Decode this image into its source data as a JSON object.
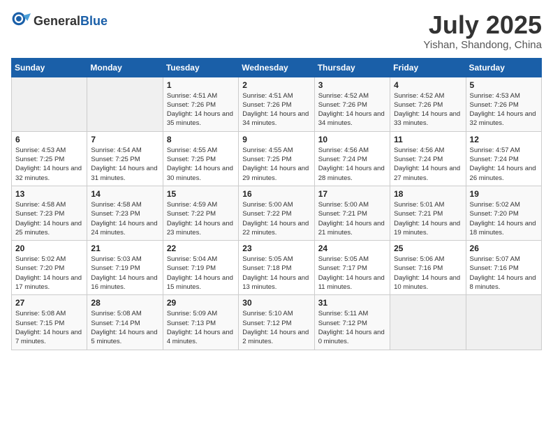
{
  "header": {
    "logo_general": "General",
    "logo_blue": "Blue",
    "month": "July 2025",
    "location": "Yishan, Shandong, China"
  },
  "weekdays": [
    "Sunday",
    "Monday",
    "Tuesday",
    "Wednesday",
    "Thursday",
    "Friday",
    "Saturday"
  ],
  "weeks": [
    [
      {
        "day": "",
        "sunrise": "",
        "sunset": "",
        "daylight": ""
      },
      {
        "day": "",
        "sunrise": "",
        "sunset": "",
        "daylight": ""
      },
      {
        "day": "1",
        "sunrise": "Sunrise: 4:51 AM",
        "sunset": "Sunset: 7:26 PM",
        "daylight": "Daylight: 14 hours and 35 minutes."
      },
      {
        "day": "2",
        "sunrise": "Sunrise: 4:51 AM",
        "sunset": "Sunset: 7:26 PM",
        "daylight": "Daylight: 14 hours and 34 minutes."
      },
      {
        "day": "3",
        "sunrise": "Sunrise: 4:52 AM",
        "sunset": "Sunset: 7:26 PM",
        "daylight": "Daylight: 14 hours and 34 minutes."
      },
      {
        "day": "4",
        "sunrise": "Sunrise: 4:52 AM",
        "sunset": "Sunset: 7:26 PM",
        "daylight": "Daylight: 14 hours and 33 minutes."
      },
      {
        "day": "5",
        "sunrise": "Sunrise: 4:53 AM",
        "sunset": "Sunset: 7:26 PM",
        "daylight": "Daylight: 14 hours and 32 minutes."
      }
    ],
    [
      {
        "day": "6",
        "sunrise": "Sunrise: 4:53 AM",
        "sunset": "Sunset: 7:25 PM",
        "daylight": "Daylight: 14 hours and 32 minutes."
      },
      {
        "day": "7",
        "sunrise": "Sunrise: 4:54 AM",
        "sunset": "Sunset: 7:25 PM",
        "daylight": "Daylight: 14 hours and 31 minutes."
      },
      {
        "day": "8",
        "sunrise": "Sunrise: 4:55 AM",
        "sunset": "Sunset: 7:25 PM",
        "daylight": "Daylight: 14 hours and 30 minutes."
      },
      {
        "day": "9",
        "sunrise": "Sunrise: 4:55 AM",
        "sunset": "Sunset: 7:25 PM",
        "daylight": "Daylight: 14 hours and 29 minutes."
      },
      {
        "day": "10",
        "sunrise": "Sunrise: 4:56 AM",
        "sunset": "Sunset: 7:24 PM",
        "daylight": "Daylight: 14 hours and 28 minutes."
      },
      {
        "day": "11",
        "sunrise": "Sunrise: 4:56 AM",
        "sunset": "Sunset: 7:24 PM",
        "daylight": "Daylight: 14 hours and 27 minutes."
      },
      {
        "day": "12",
        "sunrise": "Sunrise: 4:57 AM",
        "sunset": "Sunset: 7:24 PM",
        "daylight": "Daylight: 14 hours and 26 minutes."
      }
    ],
    [
      {
        "day": "13",
        "sunrise": "Sunrise: 4:58 AM",
        "sunset": "Sunset: 7:23 PM",
        "daylight": "Daylight: 14 hours and 25 minutes."
      },
      {
        "day": "14",
        "sunrise": "Sunrise: 4:58 AM",
        "sunset": "Sunset: 7:23 PM",
        "daylight": "Daylight: 14 hours and 24 minutes."
      },
      {
        "day": "15",
        "sunrise": "Sunrise: 4:59 AM",
        "sunset": "Sunset: 7:22 PM",
        "daylight": "Daylight: 14 hours and 23 minutes."
      },
      {
        "day": "16",
        "sunrise": "Sunrise: 5:00 AM",
        "sunset": "Sunset: 7:22 PM",
        "daylight": "Daylight: 14 hours and 22 minutes."
      },
      {
        "day": "17",
        "sunrise": "Sunrise: 5:00 AM",
        "sunset": "Sunset: 7:21 PM",
        "daylight": "Daylight: 14 hours and 21 minutes."
      },
      {
        "day": "18",
        "sunrise": "Sunrise: 5:01 AM",
        "sunset": "Sunset: 7:21 PM",
        "daylight": "Daylight: 14 hours and 19 minutes."
      },
      {
        "day": "19",
        "sunrise": "Sunrise: 5:02 AM",
        "sunset": "Sunset: 7:20 PM",
        "daylight": "Daylight: 14 hours and 18 minutes."
      }
    ],
    [
      {
        "day": "20",
        "sunrise": "Sunrise: 5:02 AM",
        "sunset": "Sunset: 7:20 PM",
        "daylight": "Daylight: 14 hours and 17 minutes."
      },
      {
        "day": "21",
        "sunrise": "Sunrise: 5:03 AM",
        "sunset": "Sunset: 7:19 PM",
        "daylight": "Daylight: 14 hours and 16 minutes."
      },
      {
        "day": "22",
        "sunrise": "Sunrise: 5:04 AM",
        "sunset": "Sunset: 7:19 PM",
        "daylight": "Daylight: 14 hours and 15 minutes."
      },
      {
        "day": "23",
        "sunrise": "Sunrise: 5:05 AM",
        "sunset": "Sunset: 7:18 PM",
        "daylight": "Daylight: 14 hours and 13 minutes."
      },
      {
        "day": "24",
        "sunrise": "Sunrise: 5:05 AM",
        "sunset": "Sunset: 7:17 PM",
        "daylight": "Daylight: 14 hours and 11 minutes."
      },
      {
        "day": "25",
        "sunrise": "Sunrise: 5:06 AM",
        "sunset": "Sunset: 7:16 PM",
        "daylight": "Daylight: 14 hours and 10 minutes."
      },
      {
        "day": "26",
        "sunrise": "Sunrise: 5:07 AM",
        "sunset": "Sunset: 7:16 PM",
        "daylight": "Daylight: 14 hours and 8 minutes."
      }
    ],
    [
      {
        "day": "27",
        "sunrise": "Sunrise: 5:08 AM",
        "sunset": "Sunset: 7:15 PM",
        "daylight": "Daylight: 14 hours and 7 minutes."
      },
      {
        "day": "28",
        "sunrise": "Sunrise: 5:08 AM",
        "sunset": "Sunset: 7:14 PM",
        "daylight": "Daylight: 14 hours and 5 minutes."
      },
      {
        "day": "29",
        "sunrise": "Sunrise: 5:09 AM",
        "sunset": "Sunset: 7:13 PM",
        "daylight": "Daylight: 14 hours and 4 minutes."
      },
      {
        "day": "30",
        "sunrise": "Sunrise: 5:10 AM",
        "sunset": "Sunset: 7:12 PM",
        "daylight": "Daylight: 14 hours and 2 minutes."
      },
      {
        "day": "31",
        "sunrise": "Sunrise: 5:11 AM",
        "sunset": "Sunset: 7:12 PM",
        "daylight": "Daylight: 14 hours and 0 minutes."
      },
      {
        "day": "",
        "sunrise": "",
        "sunset": "",
        "daylight": ""
      },
      {
        "day": "",
        "sunrise": "",
        "sunset": "",
        "daylight": ""
      }
    ]
  ]
}
